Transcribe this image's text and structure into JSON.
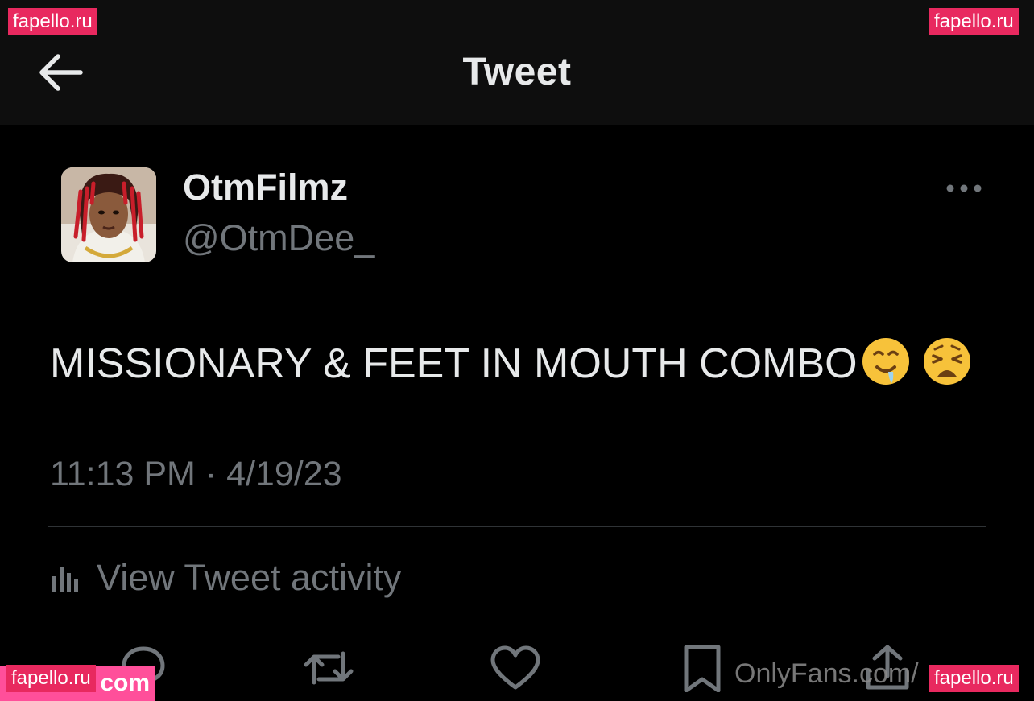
{
  "header": {
    "title": "Tweet",
    "back_icon": "arrow-left-icon"
  },
  "author": {
    "display_name": "OtmFilmz",
    "handle": "@OtmDee_",
    "avatar_icon": "avatar-portrait"
  },
  "tweet": {
    "text": "MISSIONARY & FEET IN MOUTH COMBO",
    "emojis": [
      "drooling-face",
      "weary-face"
    ],
    "timestamp": "11:13 PM · 4/19/23"
  },
  "activity": {
    "label": "View Tweet activity",
    "icon": "bar-chart-icon"
  },
  "actions": [
    "reply-icon",
    "retweet-icon",
    "like-icon",
    "bookmark-icon",
    "share-icon"
  ],
  "watermarks": {
    "top_left": "fapello.ru",
    "top_right": "fapello.ru",
    "bottom_left": "fapello.ru",
    "bottom_left_suffix": "com",
    "bottom_right": "fapello.ru",
    "onlyfans": "OnlyFans.com/"
  },
  "colors": {
    "background": "#000000",
    "header_bg": "#0e0e0e",
    "muted": "#71767b",
    "text": "#e7e9ea",
    "watermark": "#e8295f"
  }
}
